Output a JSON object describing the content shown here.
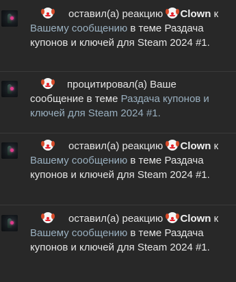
{
  "notifications": [
    {
      "type": "reaction",
      "action": "оставил(а) реакцию",
      "reaction_name": "Clown",
      "to_prefix": "к",
      "target_link": "Вашему сообщению",
      "in_thread": "в теме",
      "thread": "Раздача купонов и ключей для Steam 2024 #1."
    },
    {
      "type": "quote",
      "action": "процитировал(а) Ваше сообщение в теме",
      "thread_link": "Раздача купонов и ключей для Steam 2024 #1."
    },
    {
      "type": "reaction",
      "action": "оставил(а) реакцию",
      "reaction_name": "Clown",
      "to_prefix": "к",
      "target_link": "Вашему сообщению",
      "in_thread": "в теме",
      "thread": "Раздача купонов и ключей для Steam 2024 #1."
    },
    {
      "type": "reaction",
      "action": "оставил(а) реакцию",
      "reaction_name": "Clown",
      "to_prefix": "к",
      "target_link": "Вашему сообщению",
      "in_thread": "в теме",
      "thread": "Раздача купонов и ключей для Steam 2024 #1."
    }
  ],
  "icons": {
    "avatar": "user-avatar",
    "reaction": "clown-face-emoji"
  },
  "colors": {
    "background": "#282828",
    "text": "#e6e6e6",
    "link": "#9ab0c0"
  }
}
